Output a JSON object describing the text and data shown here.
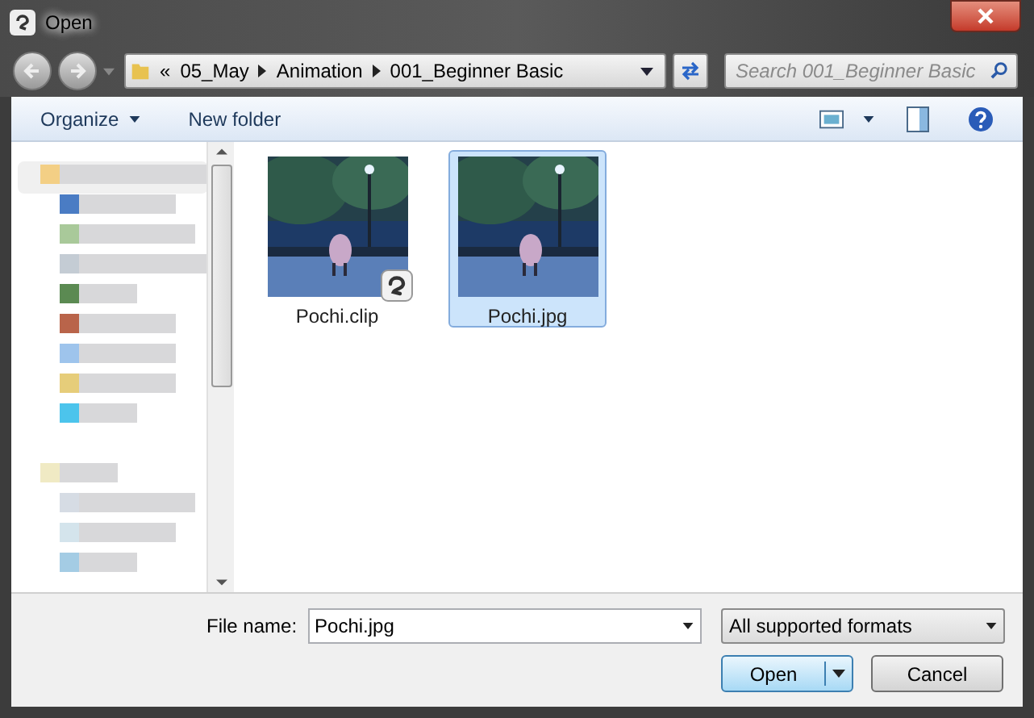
{
  "window": {
    "title": "Open"
  },
  "address_bar": {
    "overflow": "«",
    "path": [
      "05_May",
      "Animation",
      "001_Beginner Basic"
    ]
  },
  "search": {
    "placeholder": "Search 001_Beginner Basic"
  },
  "toolbar": {
    "items": [
      "Organize",
      "New folder"
    ]
  },
  "files": [
    {
      "name": "Pochi.clip",
      "selected": false,
      "badge": true
    },
    {
      "name": "Pochi.jpg",
      "selected": true,
      "badge": false
    }
  ],
  "file_name": {
    "label": "File name:",
    "value": "Pochi.jpg"
  },
  "file_type": {
    "value": "All supported formats"
  },
  "buttons": [
    {
      "label": "Open",
      "kind": "split"
    },
    {
      "label": "Cancel",
      "kind": "plain"
    }
  ]
}
